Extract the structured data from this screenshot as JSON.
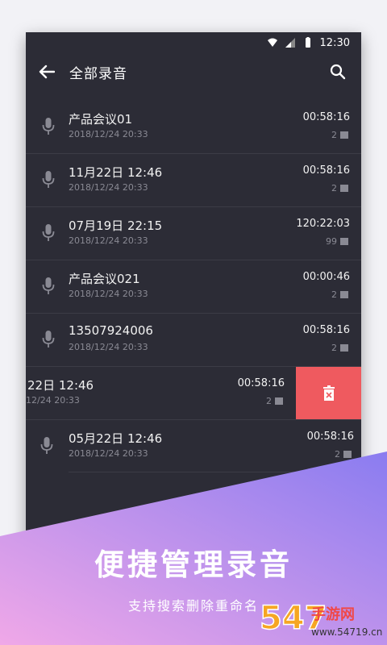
{
  "status_bar": {
    "time": "12:30"
  },
  "app_bar": {
    "title": "全部录音"
  },
  "recordings": [
    {
      "name": "产品会议01",
      "date": "2018/12/24 20:33",
      "duration": "00:58:16",
      "count": "2"
    },
    {
      "name": "11月22日  12:46",
      "date": "2018/12/24 20:33",
      "duration": "00:58:16",
      "count": "2"
    },
    {
      "name": "07月19日  22:15",
      "date": "2018/12/24 20:33",
      "duration": "120:22:03",
      "count": "99"
    },
    {
      "name": "产品会议021",
      "date": "2018/12/24 20:33",
      "duration": "00:00:46",
      "count": "2"
    },
    {
      "name": "13507924006",
      "date": "2018/12/24 20:33",
      "duration": "00:58:16",
      "count": "2"
    },
    {
      "name": "22日  12:46",
      "date": "12/24 20:33",
      "duration": "00:58:16",
      "count": "2"
    },
    {
      "name": "05月22日  12:46",
      "date": "2018/12/24 20:33",
      "duration": "00:58:16",
      "count": "2"
    }
  ],
  "colors": {
    "background": "#2c2c36",
    "delete": "#ef5a5f",
    "banner_start": "#f0a8e8",
    "banner_end": "#8a7cf0"
  },
  "icons": {
    "back": "arrow-left-icon",
    "search": "search-icon",
    "mic": "mic-icon",
    "delete": "trash-icon",
    "flag": "flag-icon"
  },
  "promo": {
    "headline": "便捷管理录音",
    "subtitle": "支持搜索删除重命名"
  },
  "watermark": {
    "text": "54719手游网",
    "url": "www.54719.cn"
  }
}
